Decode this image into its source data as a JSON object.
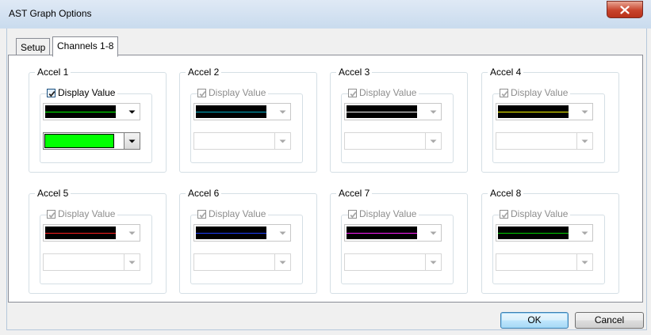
{
  "window": {
    "title": "AST Graph Options"
  },
  "tabs": [
    {
      "label": "Setup",
      "active": false
    },
    {
      "label": "Channels 1-8",
      "active": true
    }
  ],
  "display_value_label": "Display Value",
  "channels": [
    {
      "name": "Accel 1",
      "checked": true,
      "enabled": true,
      "line_color": "#00ff00",
      "fill_color": "#00ff00"
    },
    {
      "name": "Accel 2",
      "checked": true,
      "enabled": false,
      "line_color": "#00b0c8",
      "fill_color": ""
    },
    {
      "name": "Accel 3",
      "checked": true,
      "enabled": false,
      "line_color": "#ffffff",
      "fill_color": ""
    },
    {
      "name": "Accel 4",
      "checked": true,
      "enabled": false,
      "line_color": "#ffff00",
      "fill_color": ""
    },
    {
      "name": "Accel 5",
      "checked": true,
      "enabled": false,
      "line_color": "#ff2020",
      "fill_color": ""
    },
    {
      "name": "Accel 6",
      "checked": true,
      "enabled": false,
      "line_color": "#2040ff",
      "fill_color": ""
    },
    {
      "name": "Accel 7",
      "checked": true,
      "enabled": false,
      "line_color": "#ff20ff",
      "fill_color": ""
    },
    {
      "name": "Accel 8",
      "checked": true,
      "enabled": false,
      "line_color": "#00d000",
      "fill_color": ""
    }
  ],
  "buttons": {
    "ok": "OK",
    "cancel": "Cancel"
  }
}
